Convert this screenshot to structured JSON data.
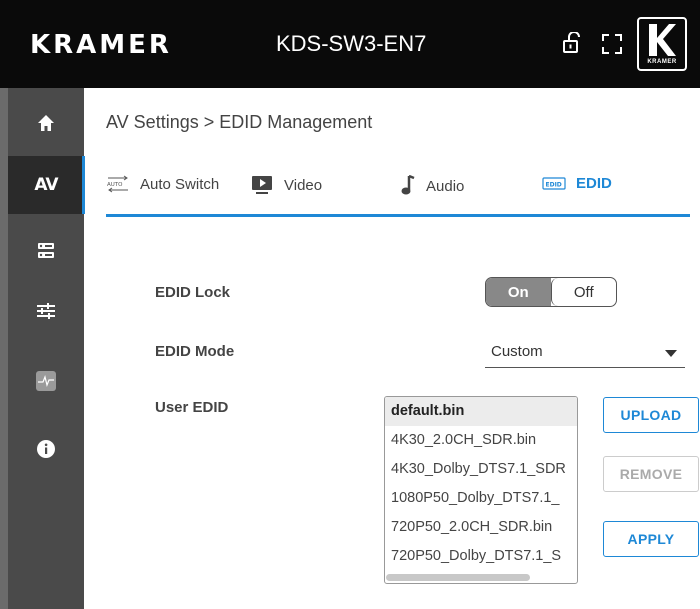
{
  "header": {
    "logo": "KRAMER",
    "device_name": "KDS-SW3-EN7",
    "brand_caption": "KRAMER"
  },
  "sidebar": {
    "items": [
      {
        "name": "home",
        "icon": "home-icon"
      },
      {
        "name": "av",
        "label": "AV",
        "active": true
      },
      {
        "name": "settings",
        "icon": "device-settings-icon"
      },
      {
        "name": "adjust",
        "icon": "sliders-icon"
      },
      {
        "name": "diagnostics",
        "icon": "pulse-icon"
      },
      {
        "name": "info",
        "icon": "info-icon"
      }
    ]
  },
  "breadcrumb": "AV Settings > EDID Management",
  "tabs": [
    {
      "label": "Auto Switch",
      "icon": "auto-switch-icon",
      "icon_text": "AUTO"
    },
    {
      "label": "Video",
      "icon": "video-icon"
    },
    {
      "label": "Audio",
      "icon": "music-note-icon"
    },
    {
      "label": "EDID",
      "icon": "edid-icon",
      "icon_text": "EDID",
      "active": true
    }
  ],
  "edid_lock": {
    "label": "EDID Lock",
    "on_label": "On",
    "off_label": "Off",
    "value": "On"
  },
  "edid_mode": {
    "label": "EDID Mode",
    "value": "Custom"
  },
  "user_edid": {
    "label": "User EDID",
    "files": [
      "default.bin",
      "4K30_2.0CH_SDR.bin",
      "4K30_Dolby_DTS7.1_SDR",
      "1080P50_Dolby_DTS7.1_",
      "720P50_2.0CH_SDR.bin",
      "720P50_Dolby_DTS7.1_S"
    ],
    "selected": "default.bin"
  },
  "buttons": {
    "upload": "UPLOAD",
    "remove": "REMOVE",
    "apply": "APPLY"
  },
  "colors": {
    "accent": "#1e88d6",
    "header_bg": "#0a0a0a",
    "sidebar_bg": "#4a4a4a",
    "toggle_on_bg": "#888888"
  }
}
